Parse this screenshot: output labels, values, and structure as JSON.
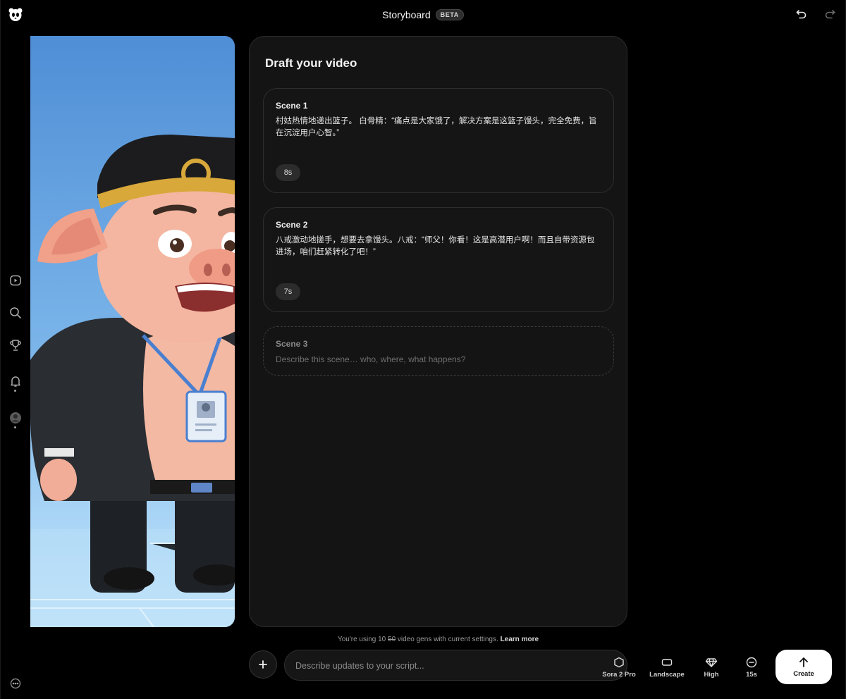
{
  "header": {
    "title": "Storyboard",
    "badge": "BETA"
  },
  "icons": {
    "logo": "sora-logo-icon",
    "undo": "undo-icon",
    "redo": "redo-icon",
    "nav": [
      "video-icon",
      "search-icon",
      "trophy-icon",
      "bell-icon",
      "profile-icon"
    ],
    "more": "more-icon"
  },
  "panel": {
    "title": "Draft your video",
    "scenes": [
      {
        "label": "Scene 1",
        "text": "村姑热情地递出篮子。 白骨精：“痛点是大家饿了，解决方案是这篮子馒头，完全免费，旨在沉淀用户心智。”",
        "duration": "8s"
      },
      {
        "label": "Scene 2",
        "text": "八戒激动地搓手，想要去拿馒头。八戒：“师父！你看！这是高潜用户啊！而且自带资源包进场，咱们赶紧转化了吧！”",
        "duration": "7s"
      },
      {
        "label": "Scene 3",
        "placeholder": "Describe this scene… who, where, what happens?"
      }
    ]
  },
  "usage": {
    "prefix": "You're using 10",
    "struck": "50",
    "suffix": "video gens with current settings.",
    "link": "Learn more"
  },
  "prompt": {
    "placeholder": "Describe updates to your script..."
  },
  "options": {
    "model": "Sora 2 Pro",
    "orientation": "Landscape",
    "quality": "High",
    "duration": "15s"
  },
  "create_label": "Create",
  "colors": {
    "background": "#000000",
    "panel": "#141414",
    "create_button": "#ffffff"
  }
}
